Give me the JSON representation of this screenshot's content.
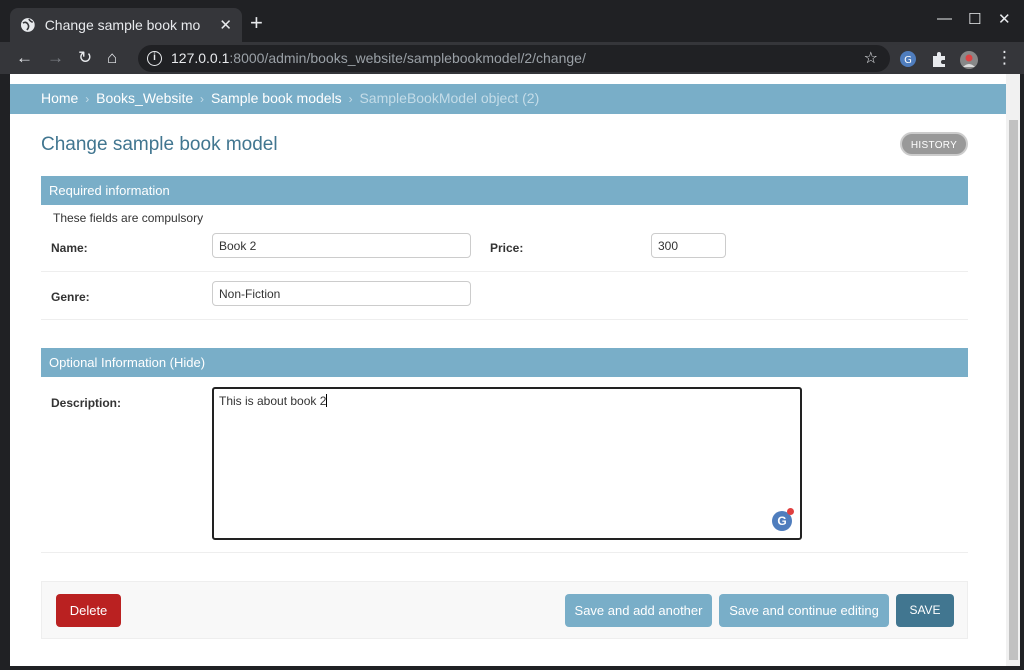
{
  "browser": {
    "tab_title": "Change sample book mo",
    "url_host": "127.0.0.1",
    "url_rest": ":8000/admin/books_website/samplebookmodel/2/change/"
  },
  "breadcrumbs": {
    "home": "Home",
    "app": "Books_Website",
    "model": "Sample book models",
    "current": "SampleBookModel object (2)",
    "separator": "›"
  },
  "content": {
    "title": "Change sample book model",
    "history_label": "HISTORY"
  },
  "required_section": {
    "heading": "Required information",
    "hint": "These fields are compulsory",
    "name_label": "Name:",
    "name_value": "Book 2",
    "price_label": "Price:",
    "price_value": "300",
    "genre_label": "Genre:",
    "genre_value": "Non-Fiction"
  },
  "optional_section": {
    "heading": "Optional Information (Hide)",
    "description_label": "Description:",
    "description_value": "This is about book 2"
  },
  "submit_row": {
    "delete_label": "Delete",
    "save_add_another_label": "Save and add another",
    "save_continue_label": "Save and continue editing",
    "save_label": "SAVE"
  },
  "colors": {
    "header_blue": "#79aec8",
    "title_blue": "#417690",
    "delete_red": "#ba2121"
  }
}
